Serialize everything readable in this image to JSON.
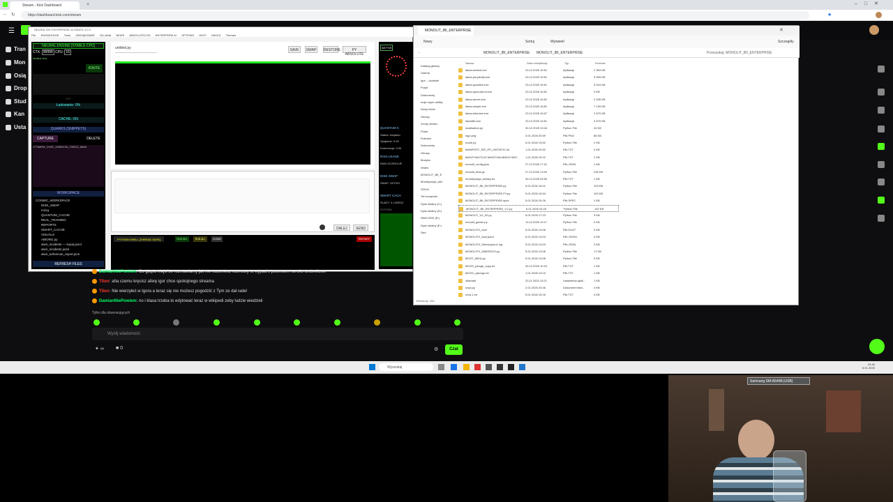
{
  "browser": {
    "tab_title": "Stream - Kick Dashboard",
    "url": "https://dashboard.kick.com/stream"
  },
  "sidebar": {
    "items": [
      {
        "label": "Tran"
      },
      {
        "label": "Mon"
      },
      {
        "label": "Osią"
      },
      {
        "label": "Drop"
      },
      {
        "label": "Stud"
      },
      {
        "label": "Kan"
      },
      {
        "label": "Usta"
      }
    ]
  },
  "ide": {
    "title": "NEURAL IDE ENTERPRISE ULTIMATE 4.0.9",
    "menu": [
      "File",
      "KNOWLEDGE",
      "Tools",
      "ZARZĄDZANIE",
      "OLLAMA",
      "NEWS",
      "ABSOLUTECOD",
      "ENTERPRISE AI",
      "OPTIONS",
      "HELP",
      "HACKS",
      "Themes"
    ],
    "engine_header": "NEURAL ENGINE [STABLE-CPU]",
    "ctx_label": "CTX:",
    "ctx_value": "99999",
    "cpu_label": "CPU:",
    "cpu_value": "16",
    "stable_tag": "[STABLE CPU]",
    "ignite": "IGNITE",
    "load_label": "OFF",
    "loading": "Ładowanie: 0%",
    "cache": "CACHE: ON",
    "quarks_header": "QUARKS (SNIPPETS)",
    "capture": "CAPTURE",
    "delete": "DELETE",
    "snippet": "CTXMEM_CHAT_20260105_230012_8648",
    "workspace_header": "WORKSPACE",
    "tree": [
      "COSMIC_WORKSPACE",
      "DISK_SWAP",
      "mózg",
      "QUANTUM_CACHE",
      "REAL_TRAINING",
      "REPORTS",
      "SMART_CACHE",
      "VISUALS",
      "AIBORG.py",
      "aiwir_incidents — kopia.jsonl",
      "aiwir_incidents.jsonl",
      "aiwir_turboscan_report.json"
    ],
    "refresh": "REFRESH FILES",
    "filename": "untitled.py",
    "save": "SAVE",
    "swap": "SWAP",
    "restore": "RESTORE",
    "py_absolute": "PY ABSOLUTE",
    "dalej": "DALEJ",
    "send": "SEND",
    "shell_title": "PYTHON SHELL [THREAD SAFE]",
    "run_sel": "RUN SEL",
    "run_all": "RUN ALL",
    "clear": "CLEAR",
    "restart": "RESTART",
    "right": {
      "aktyw": "AKTYW",
      "quantum": "QUANTUM C",
      "status": "Status: inicjalizo",
      "splatanie": "Splątanie: 0.00",
      "koherencja": "Koherencja: 0.00",
      "ram": "RAM USAGE",
      "ram_val": "RAM OCZEKUJE",
      "disk": "DISK SWAP",
      "swap_val": "SWAP: OZYWY",
      "smart": "SMART CACH",
      "slady": "ŚLADY: 4 | WIEDZ",
      "system": "SYSTEM"
    }
  },
  "explorer": {
    "title": "MONOLIT_IBI_ENTERPRISE",
    "new": "Nowy",
    "sort": "Sortuj",
    "view": "Wyświetl",
    "details": "Szczegóły",
    "path": [
      "MONOLIT_IBI_ENTERPRISE",
      "MONOLIT_IBI_ENTERPRISE"
    ],
    "search": "Przeszukaj: MONOLIT_IBI_ENTERPRISE",
    "columns": [
      "Nazwa",
      "Data modyfikacji",
      "Typ",
      "Rozmiar"
    ],
    "side": [
      "Katalog główny",
      "Galeria",
      "Igor – osobiste",
      "Pulpit",
      "Dokumenty",
      "moje super skillsy",
      "Nowy folder",
      "Obrazy",
      "Zrzuty ekranu",
      "Pulpit",
      "Pobrane",
      "Dokumenty",
      "Obrazy",
      "Muzyka",
      "Wideo",
      "MONOLIT_IBI_E",
      "Monetyzacja_aml",
      "SZKIH",
      "Ten komputer",
      "Dysk lokalny (C:)",
      "Dysk lokalny (D:)",
      "RAM DISK (R:)",
      "Dysk lokalny (E:)",
      "Sieć"
    ],
    "files": [
      {
        "name": "llama-embed.exe",
        "date": "23.12.2025 16:51",
        "type": "Aplikacja",
        "size": "2 363 KB"
      },
      {
        "name": "llama-perplexity.exe",
        "date": "23.12.2025 16:51",
        "type": "Aplikacja",
        "size": "3 099 KB"
      },
      {
        "name": "llama-quantize.exe",
        "date": "23.12.2025 16:51",
        "type": "Aplikacja",
        "size": "3 044 KB"
      },
      {
        "name": "llama-speculat.cli.exe",
        "date": "23.12.2025 16:51",
        "type": "Aplikacja",
        "size": "3 KB"
      },
      {
        "name": "llama-server.exe",
        "date": "23.12.2025 16:51",
        "type": "Aplikacja",
        "size": "2 935 KB"
      },
      {
        "name": "llama-simple.exe",
        "date": "23.12.2025 16:51",
        "type": "Aplikacja",
        "size": "7 139 KB"
      },
      {
        "name": "llama-tokenize.exe",
        "date": "23.12.2025 16:07",
        "type": "Aplikacja",
        "size": "2 670 KB"
      },
      {
        "name": "llamafile.exe",
        "date": "23.12.2025 16:51",
        "type": "Aplikacja",
        "size": "3 579 KB"
      },
      {
        "name": "localisation.py",
        "date": "30.12.2025 19:44",
        "type": "Python File",
        "size": "24 KB"
      },
      {
        "name": "logo.png",
        "date": "3.01.2026 20:59",
        "type": "Plik PNG",
        "size": "86 KB"
      },
      {
        "name": "mode.py",
        "date": "6.01.2026 13:52",
        "type": "Python File",
        "size": "2 KB"
      },
      {
        "name": "MANIFEST_SIR_IPC_INSTATIC.txt",
        "date": "1.01.2026 20:52",
        "type": "Plik TXT",
        "size": "4 KB"
      },
      {
        "name": "MASZYNA PLUS MASZYNA MINUS MAT...",
        "date": "1.01.2026 19:22",
        "type": "Plik TXT",
        "size": "1 KB"
      },
      {
        "name": "monolit_config.json",
        "date": "27.12.2025 17:31",
        "type": "Plik JSON",
        "size": "1 KB"
      },
      {
        "name": "monolit_final.py",
        "date": "27.12.2025 13:29",
        "type": "Python File",
        "size": "236 KB"
      },
      {
        "name": "monetyzacja_wiedzy.txt",
        "date": "30.12.2025 09:50",
        "type": "Plik TXT",
        "size": "1 KB"
      },
      {
        "name": "MONOLIT_IBI_ENTERPRISE.py",
        "date": "5.01.2026 16:01",
        "type": "Python File",
        "size": "193 KB"
      },
      {
        "name": "MONOLIT_IBI_ENTERPRISE.PY.py",
        "date": "5.01.2026 15:54",
        "type": "Python File",
        "size": "193 KB"
      },
      {
        "name": "MONOLIT_IBI_ENTERPRISE.spec",
        "date": "5.01.2026 20:26",
        "type": "Plik SPEC",
        "size": "1 KB"
      },
      {
        "name": "MONOLIT_IBI_ENTERPRISE_V.2.py",
        "date": "6.01.2026 20:26",
        "type": "Python File",
        "size": "192 KB"
      },
      {
        "name": "MONOLIT_U2_02.py",
        "date": "5.01.2026 17:23",
        "type": "Python File",
        "size": "3 KB"
      },
      {
        "name": "monolit_gamer.py",
        "date": "13.12.2025 19:17",
        "type": "Python File",
        "size": "3 KB"
      },
      {
        "name": "MONOLITH_duzt",
        "date": "5.01.2026 13:08",
        "type": "Plik DUZT",
        "size": "3 KB"
      },
      {
        "name": "MONOLITH_duzt.json1",
        "date": "5.01.2026 13:03",
        "type": "Plik JSON1",
        "size": "3 KB"
      },
      {
        "name": "MONOLITH_Wiedzy.json1.log",
        "date": "5.01.2026 13:03",
        "type": "Plik JSON",
        "size": "3 KB"
      },
      {
        "name": "MONOLITH_ZMIERZCH.py",
        "date": "5.01.2026 13:08",
        "type": "Python File",
        "size": "17 KB"
      },
      {
        "name": "MOST_MIKA.py",
        "date": "5.01.2026 13:08",
        "type": "Python File",
        "size": "3 KB"
      },
      {
        "name": "MOZG_plunge_copy.txt",
        "date": "30.12.2025 10:23",
        "type": "Plik TXT",
        "size": "1 KB"
      },
      {
        "name": "MOZG_cykorgo.txt",
        "date": "1.01.2026 13:15",
        "type": "Plik TXT",
        "size": "1 KB"
      },
      {
        "name": "ollamabt",
        "date": "23.11.2025 13:21",
        "type": "Ustawienia aplik...",
        "size": "1 KB"
      },
      {
        "name": "onyx.py",
        "date": "2.01.2026 23:46",
        "type": "Dokument tekst...",
        "size": "4 KB"
      },
      {
        "name": "onxy 1.txt",
        "date": "5.01.2026 15:16",
        "type": "Plik TXT",
        "size": "4 KB"
      }
    ],
    "status": "Elementy: 154"
  },
  "chat": {
    "messages": [
      {
        "user": "DamianNiePowiem",
        "color": "#00ff66",
        "text": "Co głupio niejsi że rozmawiamy jak nie rozumiesz rozmowy to wypad z powrotem na oko umbrellowe"
      },
      {
        "user": "Tibor",
        "color": "#ff3333",
        "text": "aha czemu kręcisz aferę igor chce spokojnego streama"
      },
      {
        "user": "Tibor",
        "color": "#ff3333",
        "text": "Nie wierzyłeś w Igora a teraz się nie możesz pogodzić z Tym ze dał rade!"
      },
      {
        "user": "DamianNiePowiem",
        "color": "#00ff66",
        "text": "no i klasa trzeba to edytować teraz w wikipedi zeby ludzie wiedzieli"
      }
    ],
    "followers_only": "Tylko dla obserwujących",
    "placeholder": "Wyślij wiadomość",
    "points": "∞",
    "count": "0",
    "send": "Czat"
  },
  "taskbar": {
    "search": "Wyszukaj",
    "time": "23:46",
    "date": "6.01.2026"
  },
  "webcam": {
    "label": "Samsung SM-A546B [USB]"
  }
}
